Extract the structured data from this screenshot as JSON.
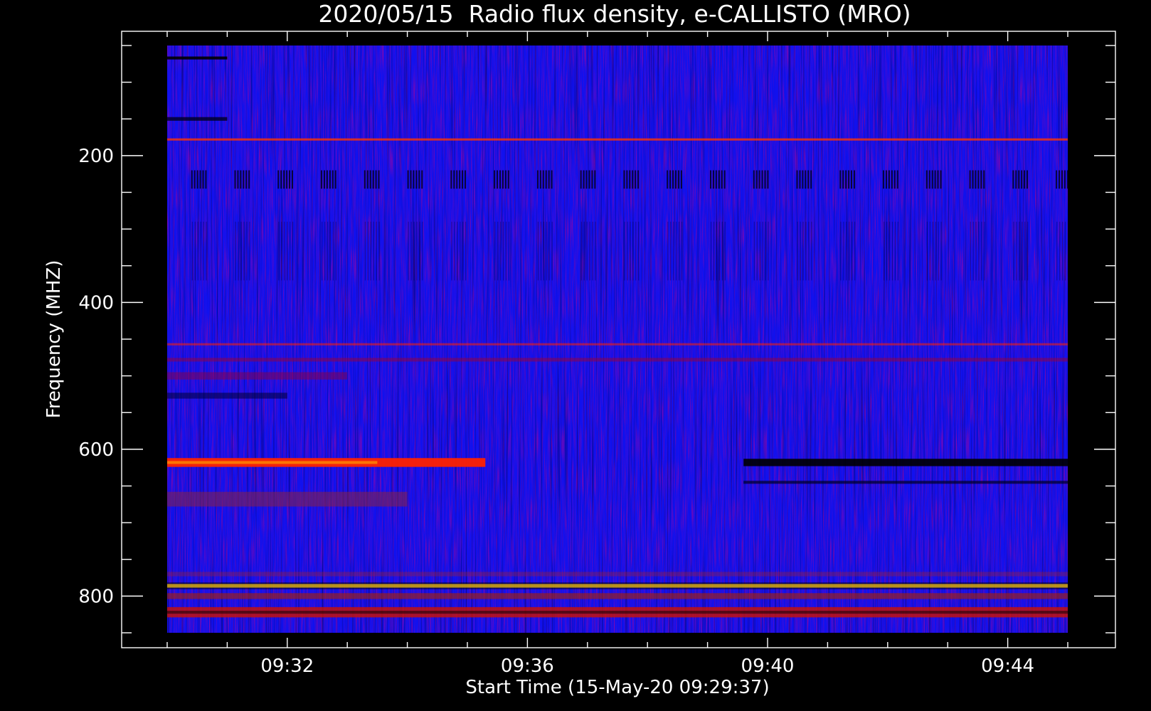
{
  "chart_data": {
    "type": "heatmap",
    "title": "2020/05/15  Radio flux density, e-CALLISTO (MRO)",
    "xlabel": "Start Time (15-May-20 09:29:37)",
    "ylabel": "Frequency (MHZ)",
    "x_start_minutes": 0.0,
    "x_end_minutes": 15.0,
    "ylim": [
      850,
      50
    ],
    "y_scale": "linear, increasing downward",
    "x_ticks": [
      {
        "label": "09:32",
        "minute": 2.0
      },
      {
        "label": "09:36",
        "minute": 6.0
      },
      {
        "label": "09:40",
        "minute": 10.0
      },
      {
        "label": "09:44",
        "minute": 14.0
      }
    ],
    "y_ticks": [
      {
        "label": "200",
        "value": 200
      },
      {
        "label": "400",
        "value": 400
      },
      {
        "label": "600",
        "value": 600
      },
      {
        "label": "800",
        "value": 800
      }
    ],
    "colormap": [
      "#000000",
      "#0000ff",
      "#ff0000",
      "#ffff00"
    ],
    "background_color": "#1111ee",
    "bands": [
      {
        "freq": 178,
        "width": 3,
        "t0": 0,
        "t1": 15,
        "color": "#ff3300",
        "opacity": 0.8
      },
      {
        "freq": 457,
        "width": 3,
        "t0": 0,
        "t1": 15,
        "color": "#ff2200",
        "opacity": 0.55
      },
      {
        "freq": 478,
        "width": 5,
        "t0": 0,
        "t1": 15,
        "color": "#990033",
        "opacity": 0.5
      },
      {
        "freq": 500,
        "width": 10,
        "t0": 0,
        "t1": 3,
        "color": "#880044",
        "opacity": 0.5
      },
      {
        "freq": 527,
        "width": 8,
        "t0": 0,
        "t1": 2,
        "color": "#000033",
        "opacity": 0.55
      },
      {
        "freq": 618,
        "width": 12,
        "t0": 0,
        "t1": 5.3,
        "color": "#ff2200",
        "opacity": 0.95
      },
      {
        "freq": 618,
        "width": 4,
        "t0": 0,
        "t1": 3.5,
        "color": "#ff9900",
        "opacity": 0.7
      },
      {
        "freq": 618,
        "width": 10,
        "t0": 9.6,
        "t1": 15,
        "color": "#000000",
        "opacity": 0.9
      },
      {
        "freq": 645,
        "width": 4,
        "t0": 9.6,
        "t1": 15,
        "color": "#000022",
        "opacity": 0.7
      },
      {
        "freq": 668,
        "width": 20,
        "t0": 0,
        "t1": 4,
        "color": "#882244",
        "opacity": 0.55
      },
      {
        "freq": 770,
        "width": 6,
        "t0": 0,
        "t1": 15,
        "color": "#aa2222",
        "opacity": 0.35
      },
      {
        "freq": 786,
        "width": 9,
        "t0": 0,
        "t1": 15,
        "color": "#000000",
        "opacity": 0.55
      },
      {
        "freq": 786,
        "width": 5,
        "t0": 0,
        "t1": 15,
        "color": "#ffcc00",
        "opacity": 0.7
      },
      {
        "freq": 800,
        "width": 8,
        "t0": 0,
        "t1": 15,
        "color": "#aa2200",
        "opacity": 0.6
      },
      {
        "freq": 822,
        "width": 14,
        "t0": 0,
        "t1": 15,
        "color": "#cc1100",
        "opacity": 0.8
      },
      {
        "freq": 822,
        "width": 4,
        "t0": 0,
        "t1": 15,
        "color": "#000000",
        "opacity": 0.5
      },
      {
        "freq": 67,
        "width": 4,
        "t0": 0,
        "t1": 1,
        "color": "#000000",
        "opacity": 0.9
      },
      {
        "freq": 150,
        "width": 5,
        "t0": 0,
        "t1": 1,
        "color": "#000022",
        "opacity": 0.8
      }
    ],
    "periodic_dark_bursts": {
      "freq_range": [
        220,
        245
      ],
      "interval_minutes": 0.72,
      "start_minute": 0.4,
      "duration_minutes": 0.28,
      "faint_freq_range": [
        290,
        370
      ]
    }
  }
}
